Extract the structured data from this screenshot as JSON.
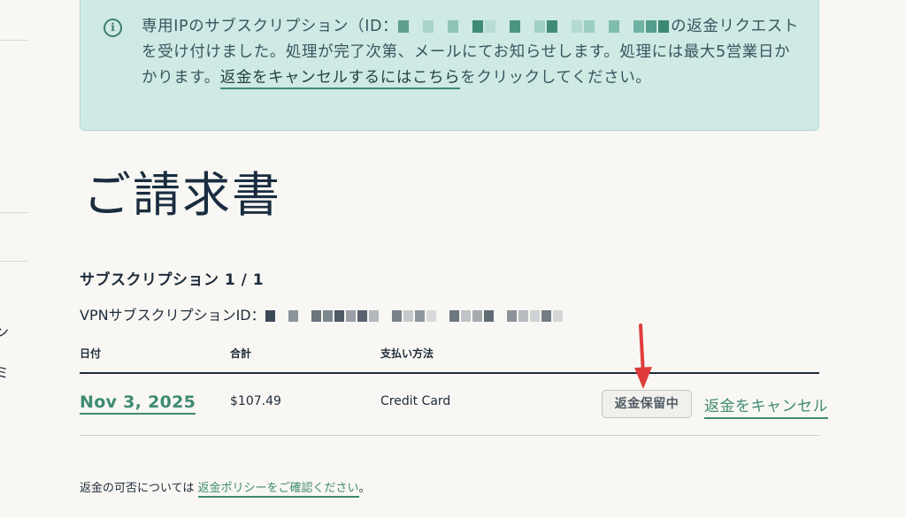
{
  "sidebar": {
    "fragment_1": "ン",
    "fragment_2": "ミ"
  },
  "notice": {
    "icon": "info-icon",
    "text_before_id": "専用IPのサブスクリプション（ID：",
    "text_after_id": "の返金リクエストを受け付けました。処理が完了次第、メールにてお知らせします。処理には最大5営業日かかります。",
    "cancel_link": "返金をキャンセルするにはこちら",
    "text_end": "をクリックしてください。"
  },
  "page": {
    "title": "ご請求書"
  },
  "subscription": {
    "count_label": "サブスクリプション 1 / 1",
    "vpn_id_label": "VPNサブスクリプションID："
  },
  "table": {
    "headers": [
      "日付",
      "合計",
      "支払い方法"
    ],
    "rows": [
      {
        "date": "Nov 3, 2025",
        "total": "$107.49",
        "payment_method": "Credit Card",
        "status": "返金保留中",
        "action": "返金をキャンセル"
      }
    ]
  },
  "footer": {
    "text": "返金の可否については",
    "policy_link": "返金ポリシーをご確認ください",
    "period": "。"
  },
  "colors": {
    "accent_green": "#3e8a71",
    "notice_bg": "#cfe9e4",
    "page_bg": "#f8f7f3",
    "annotation_red": "#e03c3c"
  }
}
